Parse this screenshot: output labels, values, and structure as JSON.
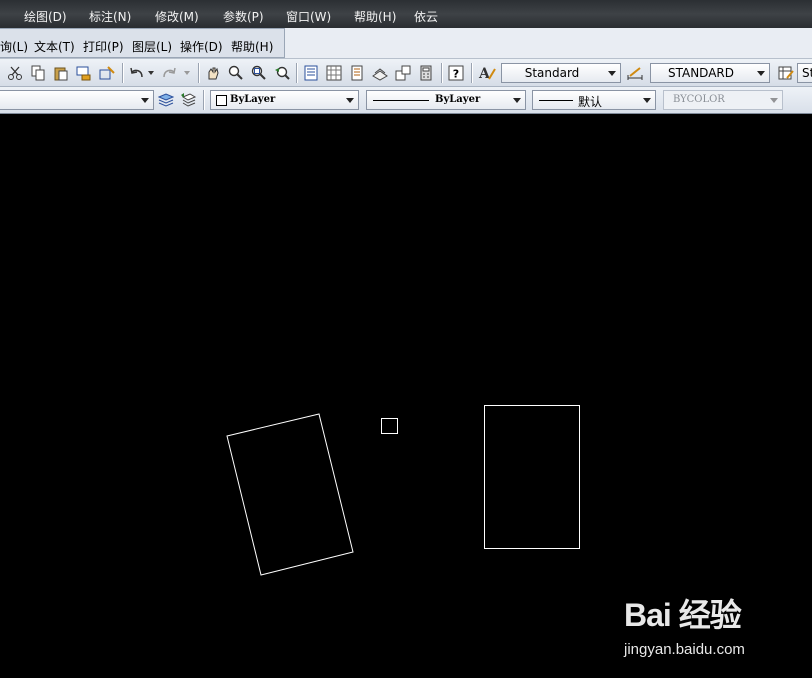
{
  "top_menu": [
    "绘图(D)",
    "标注(N)",
    "修改(M)",
    "参数(P)",
    "窗口(W)",
    "帮助(H)",
    "依云"
  ],
  "second_menu": [
    "询(L)",
    "文本(T)",
    "打印(P)",
    "图层(L)",
    "操作(D)",
    "帮助(H)"
  ],
  "toolbar": {
    "text_style": "Standard",
    "dim_style": "STANDARD",
    "trailing_text": "St"
  },
  "properties": {
    "color": "ByLayer",
    "linetype": "ByLayer",
    "lineweight": "默认",
    "plotstyle": "BYCOLOR"
  },
  "watermark": {
    "logo": "Bai 经验",
    "url": "jingyan.baidu.com"
  },
  "colors": {
    "canvas": "#000000",
    "entity_stroke": "#ffffff",
    "menubar_dark": "#2e3236"
  }
}
